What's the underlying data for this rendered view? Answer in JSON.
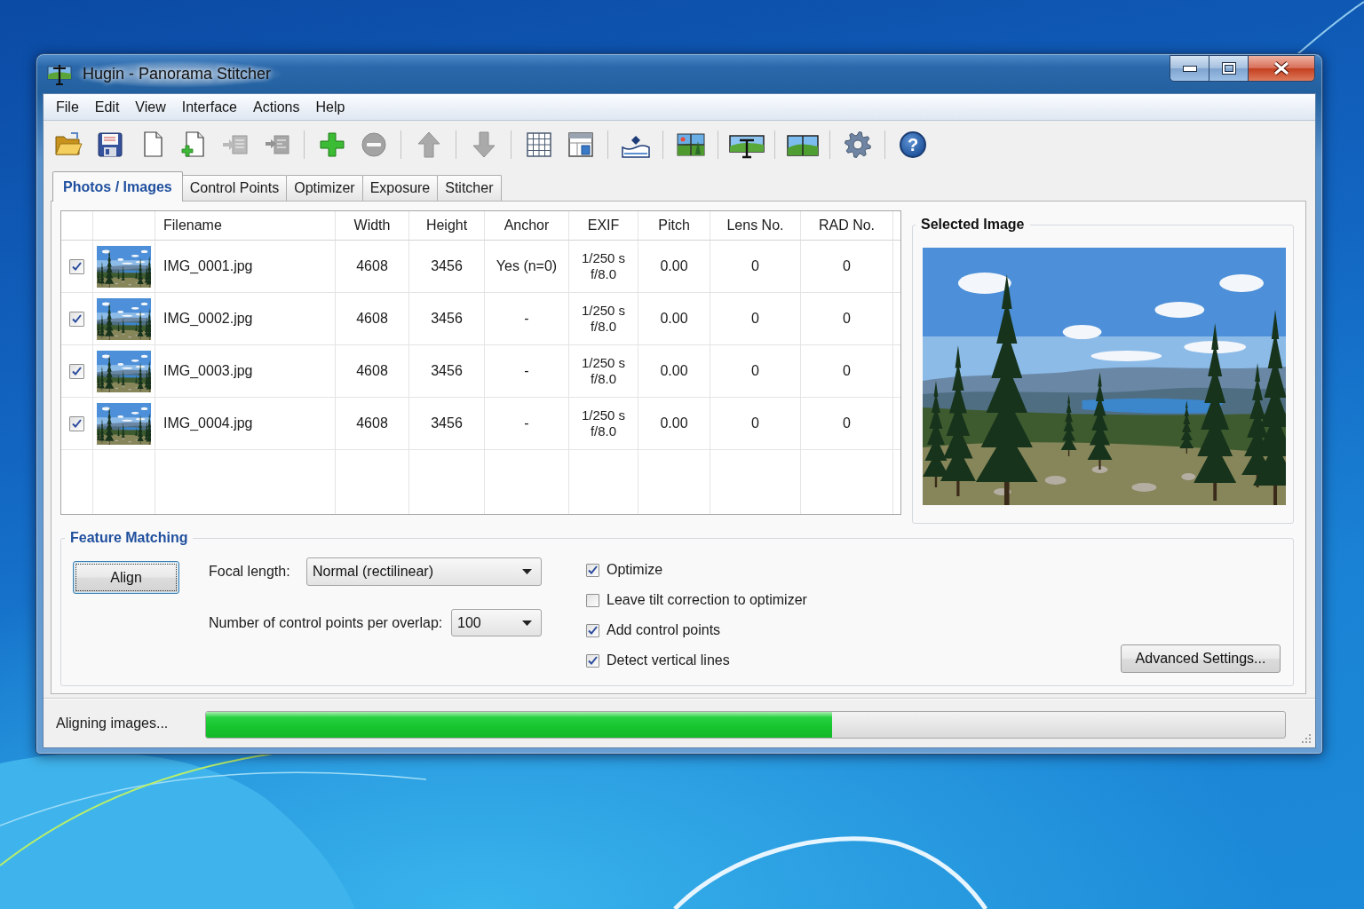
{
  "window": {
    "title": "Hugin - Panorama Stitcher"
  },
  "menu": [
    "File",
    "Edit",
    "View",
    "Interface",
    "Actions",
    "Help"
  ],
  "toolbar": [
    {
      "buttons": [
        {
          "kind": "folder",
          "disabled": false
        },
        {
          "kind": "floppy",
          "disabled": false
        },
        {
          "kind": "page",
          "disabled": false
        },
        {
          "kind": "page-plus",
          "disabled": false
        },
        {
          "kind": "import",
          "disabled": true
        },
        {
          "kind": "import-alt",
          "disabled": true
        }
      ]
    },
    {
      "buttons": [
        {
          "kind": "plus",
          "disabled": false
        },
        {
          "kind": "minus",
          "disabled": true
        }
      ]
    },
    {
      "buttons": [
        {
          "kind": "arrow-up",
          "disabled": true
        }
      ]
    },
    {
      "buttons": [
        {
          "kind": "arrow-down",
          "disabled": true
        }
      ]
    },
    {
      "buttons": [
        {
          "kind": "grid",
          "disabled": false
        },
        {
          "kind": "window",
          "disabled": false
        }
      ]
    },
    {
      "buttons": [
        {
          "kind": "marker-strip",
          "disabled": false
        }
      ]
    },
    {
      "buttons": [
        {
          "kind": "mosaic",
          "disabled": false
        }
      ]
    },
    {
      "buttons": [
        {
          "kind": "stand-panorama",
          "disabled": false
        }
      ]
    },
    {
      "buttons": [
        {
          "kind": "panorama",
          "disabled": false
        }
      ]
    },
    {
      "buttons": [
        {
          "kind": "gear",
          "disabled": false
        }
      ]
    },
    {
      "buttons": [
        {
          "kind": "help",
          "glyph": "?",
          "disabled": false
        }
      ]
    }
  ],
  "tabs": [
    {
      "label": "Photos / Images",
      "selected": true
    },
    {
      "label": "Control Points",
      "selected": false
    },
    {
      "label": "Optimizer",
      "selected": false
    },
    {
      "label": "Exposure",
      "selected": false
    },
    {
      "label": "Stitcher",
      "selected": false
    }
  ],
  "images_table": {
    "columns": [
      "Filename",
      "Width",
      "Height",
      "Anchor",
      "EXIF",
      "Pitch",
      "Lens No.",
      "RAD No."
    ],
    "rows": [
      {
        "checked": true,
        "cells": [
          "IMG_0001.jpg",
          "4608",
          "3456",
          "Yes (n=0)",
          "1/250 s\nf/8.0",
          "0.00",
          "0",
          "0"
        ]
      },
      {
        "checked": true,
        "cells": [
          "IMG_0002.jpg",
          "4608",
          "3456",
          "-",
          "1/250 s\nf/8.0",
          "0.00",
          "0",
          "0"
        ]
      },
      {
        "checked": true,
        "cells": [
          "IMG_0003.jpg",
          "4608",
          "3456",
          "-",
          "1/250 s\nf/8.0",
          "0.00",
          "0",
          "0"
        ]
      },
      {
        "checked": true,
        "cells": [
          "IMG_0004.jpg",
          "4608",
          "3456",
          "-",
          "1/250 s\nf/8.0",
          "0.00",
          "0",
          "0"
        ]
      }
    ]
  },
  "selected_image": {
    "title": "Selected Image"
  },
  "feature_matching": {
    "title": "Feature Matching",
    "align_button": {
      "label": "Align",
      "focused": true
    },
    "focal_length": {
      "label": "Focal length:",
      "value": "Normal (rectilinear)"
    },
    "control_points": {
      "label": "Number of control points per overlap:",
      "value": "100"
    },
    "options": [
      {
        "label": "Optimize",
        "checked": true
      },
      {
        "label": "Leave tilt correction to optimizer",
        "checked": false
      },
      {
        "label": "Add control points",
        "checked": true
      },
      {
        "label": "Detect vertical lines",
        "checked": true
      }
    ],
    "advanced_button": "Advanced Settings..."
  },
  "status_bar": {
    "text": "Aligning images...",
    "progress": {
      "level": 0.58
    }
  }
}
